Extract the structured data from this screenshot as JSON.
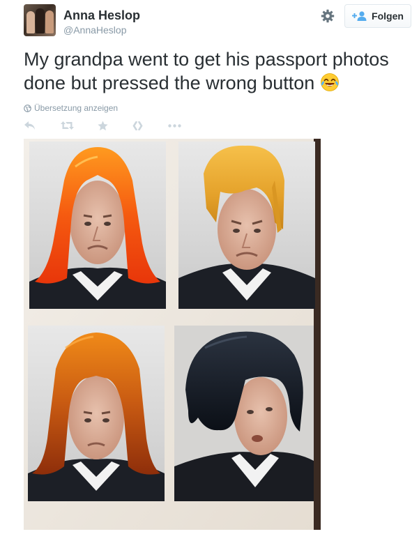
{
  "header": {
    "display_name": "Anna Heslop",
    "handle": "@AnnaHeslop",
    "follow_label": "Folgen"
  },
  "tweet": {
    "text": "My grandpa went to get his passport photos done but pressed the wrong button",
    "translate_label": "Übersetzung anzeigen"
  },
  "icons": {
    "settings": "gear-icon",
    "follow": "person-plus-icon",
    "globe": "globe-icon",
    "actions": [
      "reply-icon",
      "retweet-icon",
      "favorite-star-icon",
      "pocket-icon",
      "more-dots-icon"
    ],
    "emoji": "face-with-tears-of-joy-emoji"
  },
  "colors": {
    "follow_icon": "#55acee",
    "name_text": "#292f33",
    "muted_text": "#8899a6",
    "action_icons": "#ccd6dd"
  },
  "media": {
    "description_icon": "photo-strip-image",
    "wigs": [
      "orange",
      "blonde",
      "auburn",
      "black"
    ]
  }
}
